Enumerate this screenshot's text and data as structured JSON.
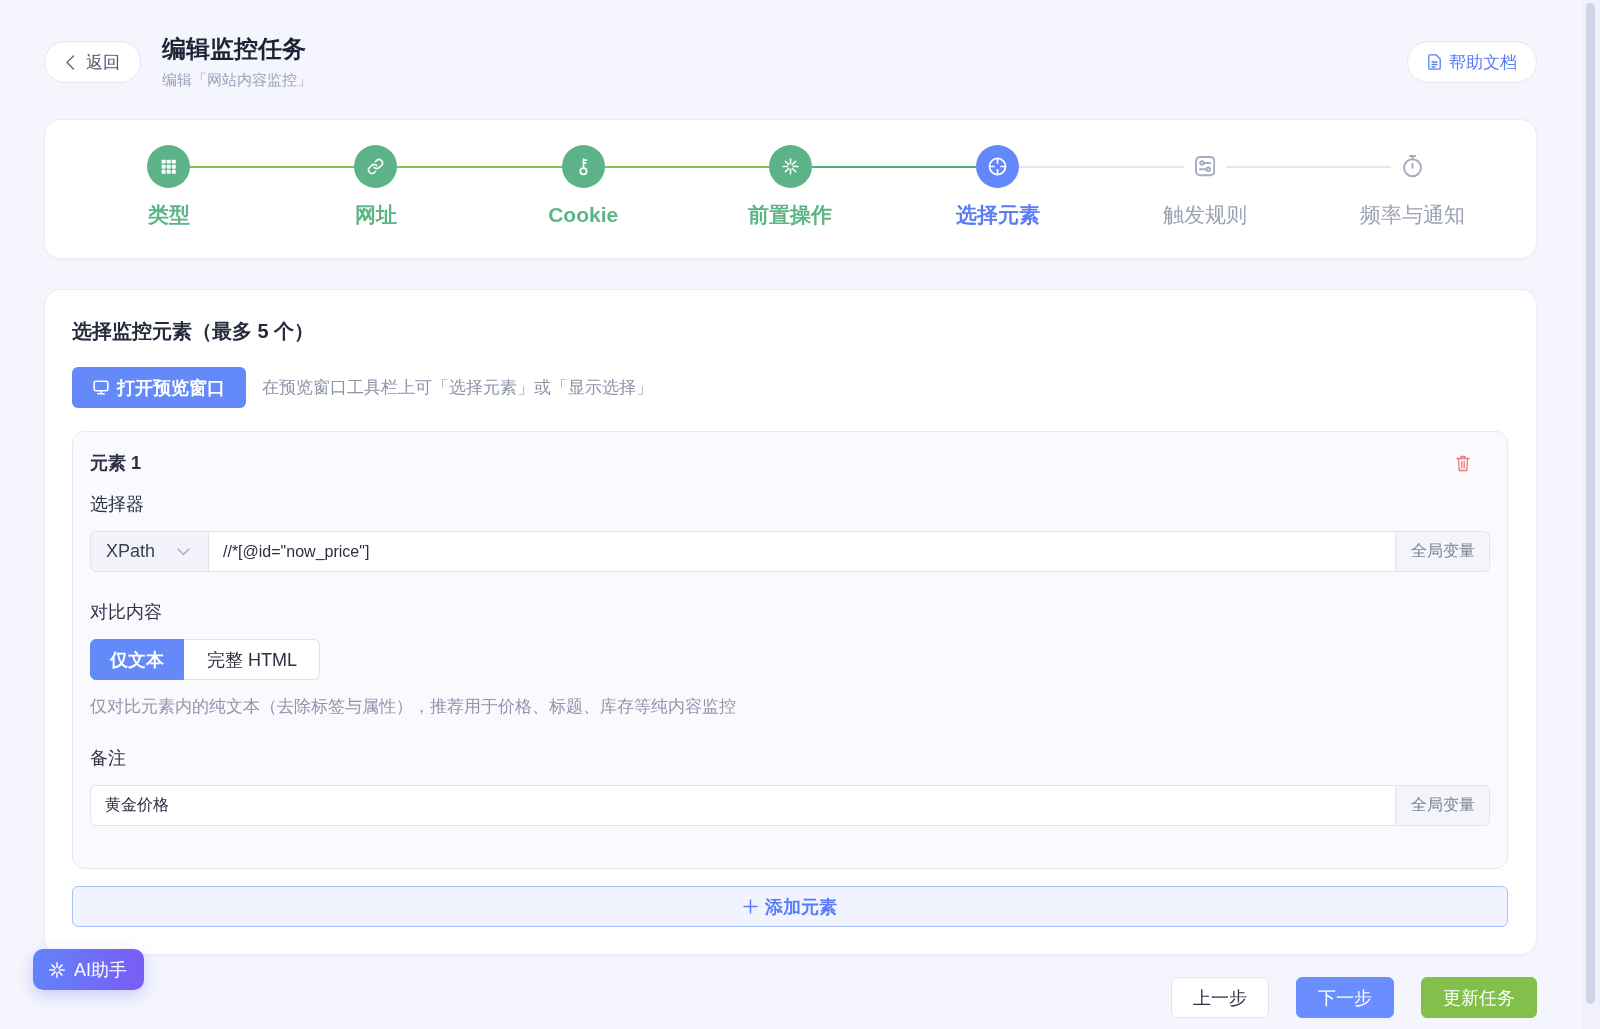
{
  "header": {
    "back_button": "返回",
    "title": "编辑监控任务",
    "subtitle": "编辑「网站内容监控」",
    "help_button": "帮助文档"
  },
  "steps": [
    {
      "label": "类型",
      "completed": true,
      "selected": false
    },
    {
      "label": "网址",
      "completed": true,
      "selected": false
    },
    {
      "label": "Cookie",
      "completed": true,
      "selected": false
    },
    {
      "label": "前置操作",
      "completed": true,
      "selected": false
    },
    {
      "label": "选择元素",
      "completed": false,
      "selected": true
    },
    {
      "label": "触发规则",
      "completed": false,
      "selected": false
    },
    {
      "label": "频率与通知",
      "completed": false,
      "selected": false
    }
  ],
  "section": {
    "title": "选择监控元素（最多 5 个）",
    "preview_button": "打开预览窗口",
    "preview_hint": "在预览窗口工具栏上可「选择元素」或「显示选择」"
  },
  "elements": [
    {
      "title": "元素 1",
      "selector_label": "选择器",
      "selector_type": "XPath",
      "selector_value": "//*[@id=\"now_price\"]",
      "selector_addon": "全局变量",
      "compare_label": "对比内容",
      "compare_options": [
        {
          "label": "仅文本",
          "selected": true
        },
        {
          "label": "完整 HTML",
          "selected": false
        }
      ],
      "compare_hint": "仅对比元素内的纯文本（去除标签与属性），推荐用于价格、标题、库存等纯内容监控",
      "note_label": "备注",
      "note_value": "黄金价格",
      "note_addon": "全局变量"
    }
  ],
  "add_button": "添加元素",
  "ai_button": "AI助手",
  "footer_buttons": [
    {
      "label": "上一步",
      "kind": "default"
    },
    {
      "label": "下一步",
      "kind": "primary"
    },
    {
      "label": "更新任务",
      "kind": "success"
    }
  ]
}
